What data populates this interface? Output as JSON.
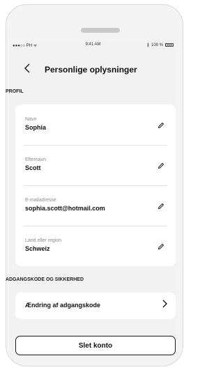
{
  "statusbar": {
    "carrier": "●●●○○ PH ᯤ",
    "time": "9:41 AM",
    "bluetooth": "∦",
    "battery_text": "100 %"
  },
  "header": {
    "back_icon": "chevron-left-icon",
    "title": "Personlige oplysninger"
  },
  "profile": {
    "section_label": "PROFIL",
    "fields": [
      {
        "label": "Navn",
        "value": "Sophia"
      },
      {
        "label": "Efternavn",
        "value": "Scott"
      },
      {
        "label": "E-mailadresse",
        "value": "sophia.scott@hotmail.com"
      },
      {
        "label": "Land eller region",
        "value": "Schweiz"
      }
    ]
  },
  "security": {
    "section_label": "ADGANGSKODE OG SIKKERHED",
    "change_password": "Ændring af adgangskode"
  },
  "delete_account": "Slet konto"
}
